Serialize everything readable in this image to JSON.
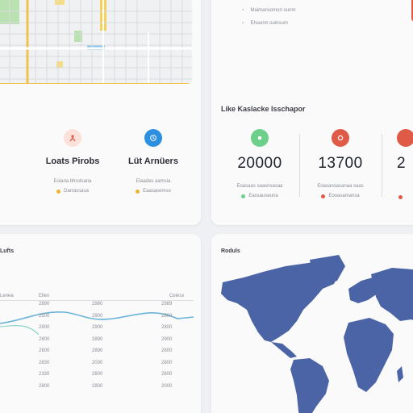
{
  "colors": {
    "page_bg": "#eef0f3",
    "card_bg": "#fafafb",
    "accent_red": "#e05a48",
    "accent_blue": "#2d8fe0",
    "accent_green": "#6ccf8a",
    "accent_orange": "#f0b233",
    "map_blue": "#4a64a5"
  },
  "left_card": {
    "metrics": [
      {
        "icon": "person-icon",
        "title": "Loats Pirobs",
        "sub": "Eoiaria bhrutsana",
        "legend": "Darrassasa"
      },
      {
        "icon": "clock-icon",
        "title": "Lüt Arnüers",
        "sub": "Elaadas aamsia",
        "legend": "Eaasasemso"
      }
    ]
  },
  "summary": {
    "top_lines": [
      "Maimansomon ounm",
      "Ehsunm ouinsum"
    ],
    "title": "Like Kaslacke lsschapor",
    "metrics": [
      {
        "icon": "leaf-icon",
        "value": "20000",
        "sub": "Eoasaas saasnsasaa",
        "legend": "Eassauseuna"
      },
      {
        "icon": "target-icon",
        "value": "13700",
        "sub": "Eoasansasanaa saas",
        "legend": "Eooasamansa"
      },
      {
        "icon": "chart-icon",
        "value": "2",
        "sub": "",
        "legend": ""
      }
    ]
  },
  "table_card": {
    "title": "Lufts",
    "headers": [
      "Lenea",
      "Ellen",
      "Celesx"
    ],
    "col2": [
      "2890",
      "2500",
      "2800",
      "2800",
      "2800",
      "2830",
      "2330",
      "2800"
    ],
    "col3": [
      "2980",
      "2900",
      "2900",
      "2890",
      "2890",
      "2030",
      "2800",
      "2800"
    ],
    "col4": [
      "2989",
      "2860",
      "2800",
      "2900",
      "2800",
      "2800",
      "2800",
      "2000"
    ]
  },
  "world_card": {
    "title": "Roduls"
  }
}
